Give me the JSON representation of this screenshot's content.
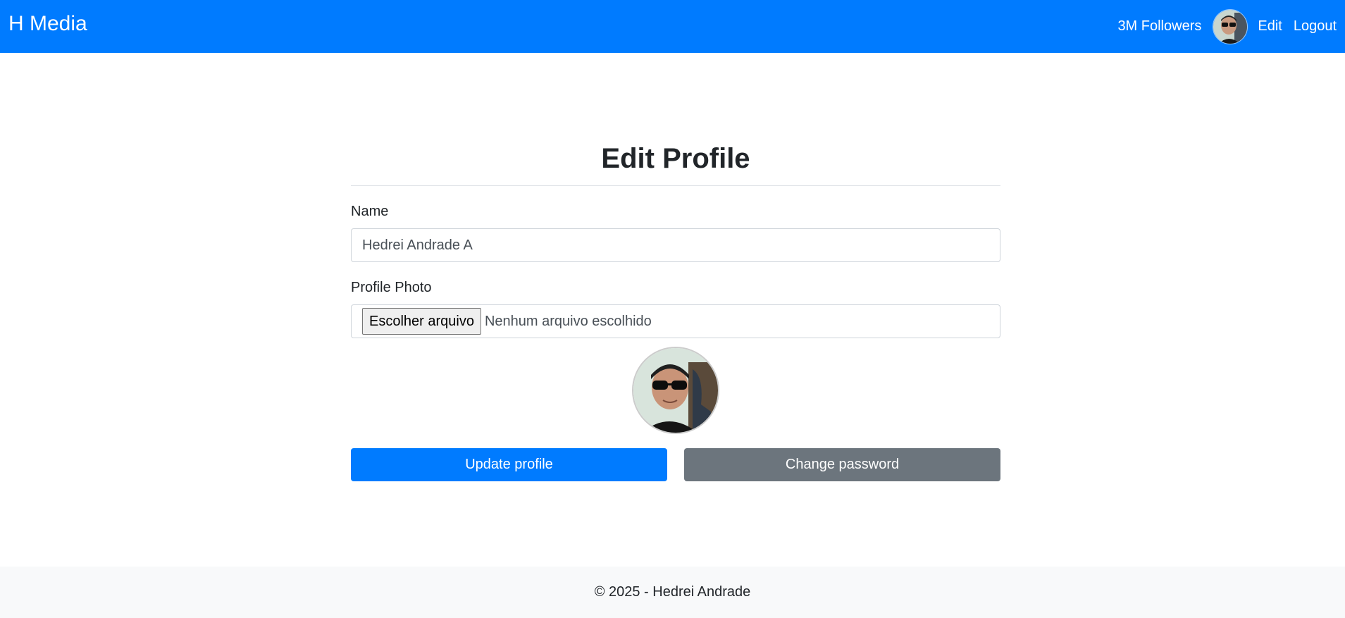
{
  "navbar": {
    "brand": "H Media",
    "followers": "3M Followers",
    "edit": "Edit",
    "logout": "Logout"
  },
  "page": {
    "title": "Edit Profile"
  },
  "form": {
    "name_label": "Name",
    "name_value": "Hedrei Andrade A",
    "photo_label": "Profile Photo",
    "file_button": "Escolher arquivo",
    "file_status": "Nenhum arquivo escolhido"
  },
  "actions": {
    "update": "Update profile",
    "change_password": "Change password"
  },
  "footer": {
    "text": "© 2025 - Hedrei Andrade"
  },
  "colors": {
    "primary": "#007bff",
    "secondary": "#6c757d",
    "footer_bg": "#f8f9fa"
  }
}
